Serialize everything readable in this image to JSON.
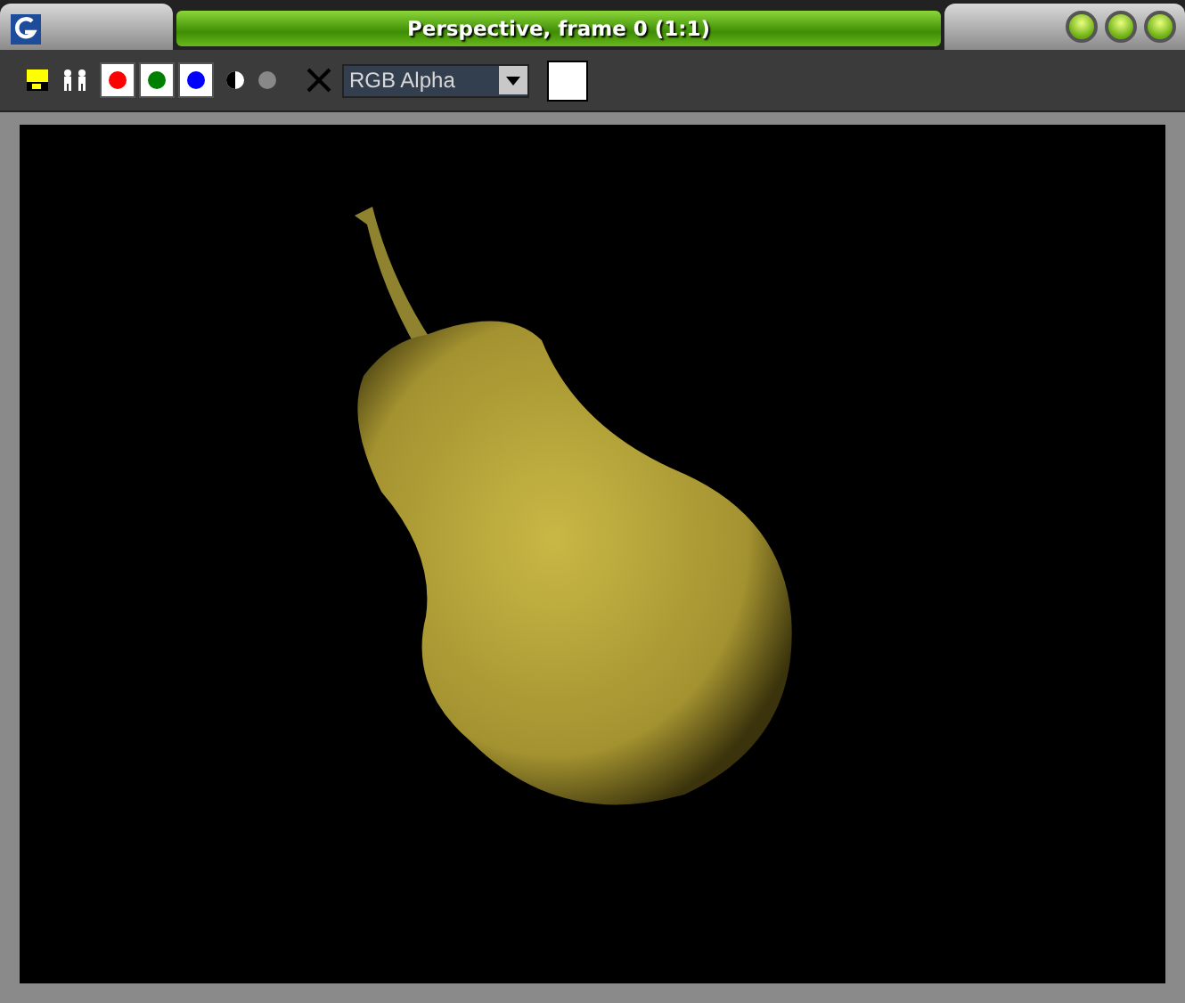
{
  "window": {
    "title": "Perspective, frame 0 (1:1)"
  },
  "toolbar": {
    "channels": [
      {
        "color": "#ff0000",
        "selected": true
      },
      {
        "color": "#008000",
        "selected": true
      },
      {
        "color": "#0000ff",
        "selected": true
      }
    ],
    "channel_dropdown": {
      "value": "RGB Alpha"
    }
  }
}
